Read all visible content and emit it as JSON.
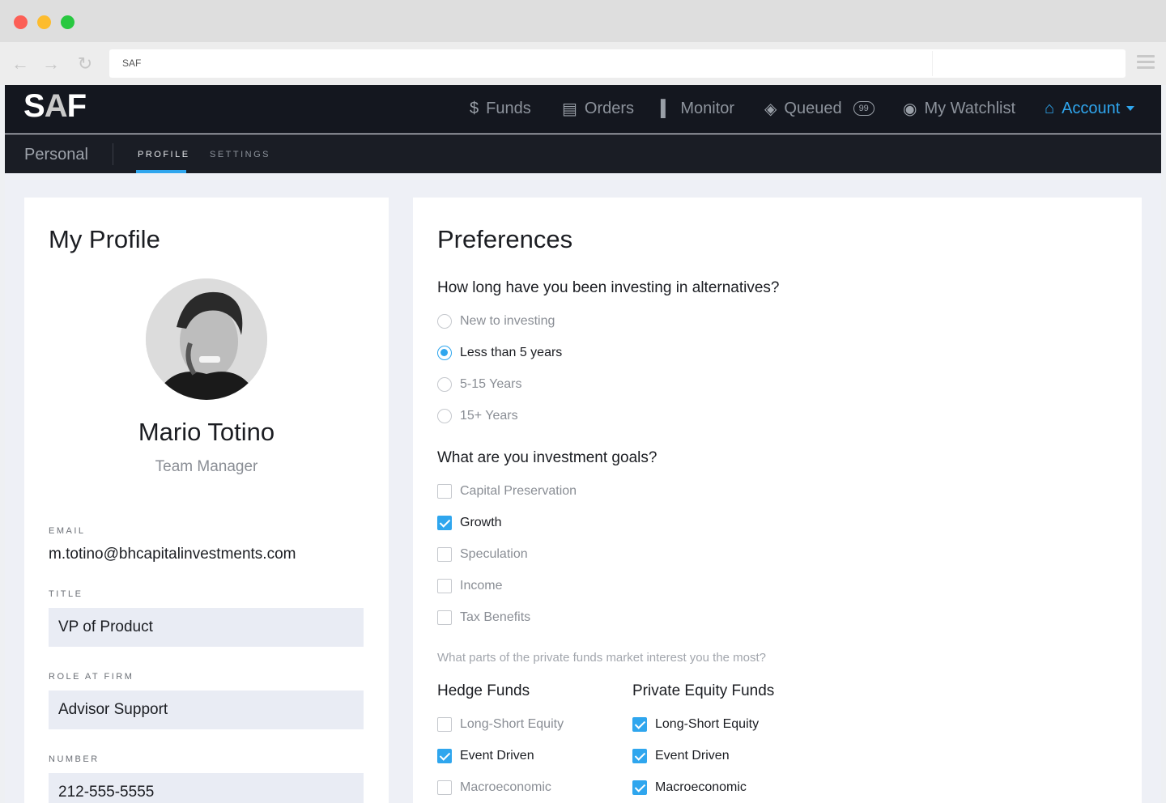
{
  "browser": {
    "address": "SAF"
  },
  "nav": {
    "logo_text": "SAF",
    "items": [
      {
        "label": "Funds",
        "icon": "dollar-icon"
      },
      {
        "label": "Orders",
        "icon": "list-icon"
      },
      {
        "label": "Monitor",
        "icon": "bar-chart-icon"
      },
      {
        "label": "Queued",
        "icon": "layers-icon",
        "badge": "99"
      },
      {
        "label": "My Watchlist",
        "icon": "eye-icon"
      },
      {
        "label": "Account",
        "icon": "home-icon",
        "active": true
      }
    ]
  },
  "subnav": {
    "title": "Personal",
    "tabs": [
      "PROFILE",
      "SETTINGS"
    ],
    "active_tab": "PROFILE"
  },
  "profile": {
    "heading": "My Profile",
    "name": "Mario Totino",
    "role": "Team Manager",
    "email_label": "EMAIL",
    "email": "m.totino@bhcapitalinvestments.com",
    "title_label": "TITLE",
    "title_value": "VP of Product",
    "role_label": "ROLE AT FIRM",
    "role_value": "Advisor Support",
    "number_label": "NUMBER",
    "number_value": "212-555-5555"
  },
  "preferences": {
    "heading": "Preferences",
    "q1": "How long have you been investing in alternatives?",
    "q1_options": [
      {
        "label": "New to investing",
        "selected": false
      },
      {
        "label": "Less than 5 years",
        "selected": true
      },
      {
        "label": "5-15 Years",
        "selected": false
      },
      {
        "label": "15+ Years",
        "selected": false
      }
    ],
    "q2": "What are you investment goals?",
    "q2_options": [
      {
        "label": "Capital Preservation",
        "checked": false
      },
      {
        "label": "Growth",
        "checked": true
      },
      {
        "label": "Speculation",
        "checked": false
      },
      {
        "label": "Income",
        "checked": false
      },
      {
        "label": "Tax Benefits",
        "checked": false
      }
    ],
    "q3": "What parts of the private funds market interest you the most?",
    "hedge_heading": "Hedge Funds",
    "hedge_options": [
      {
        "label": "Long-Short Equity",
        "checked": false
      },
      {
        "label": "Event Driven",
        "checked": true
      },
      {
        "label": "Macroeconomic",
        "checked": false
      }
    ],
    "pe_heading": "Private Equity Funds",
    "pe_options": [
      {
        "label": "Long-Short Equity",
        "checked": true
      },
      {
        "label": "Event Driven",
        "checked": true
      },
      {
        "label": "Macroeconomic",
        "checked": true
      }
    ]
  },
  "colors": {
    "accent": "#2fa6ee",
    "nav_bg": "#14171f",
    "page_bg": "#eef0f6"
  }
}
